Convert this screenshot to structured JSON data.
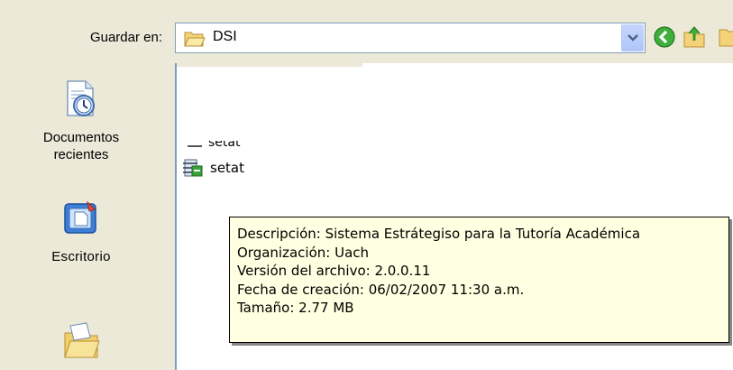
{
  "dialog": {
    "save_in_label": "Guardar en:",
    "location": "DSI"
  },
  "places": [
    {
      "label_line1": "Documentos",
      "label_line2": "recientes"
    },
    {
      "label": "Escritorio"
    },
    {
      "label": ""
    }
  ],
  "files": [
    {
      "name": "setat"
    },
    {
      "name": "setat"
    }
  ],
  "tooltip": {
    "line1": "Descripción: Sistema Estrátegiso para la Tutoría Académica",
    "line2": "Organización: Uach",
    "line3": "Versión del archivo: 2.0.0.11",
    "line4": "Fecha de creación: 06/02/2007 11:30 a.m.",
    "line5": "Tamaño: 2.77 MB"
  },
  "icons": {
    "folder": "folder-open-icon",
    "back": "back-arrow-icon",
    "up": "up-folder-icon",
    "recent": "recent-documents-icon",
    "desktop": "desktop-icon",
    "documents": "my-documents-icon",
    "exe": "setup-exe-icon"
  },
  "colors": {
    "window_bg": "#ece9d8",
    "tooltip_bg": "#ffffe1",
    "field_border": "#7f9db9"
  }
}
